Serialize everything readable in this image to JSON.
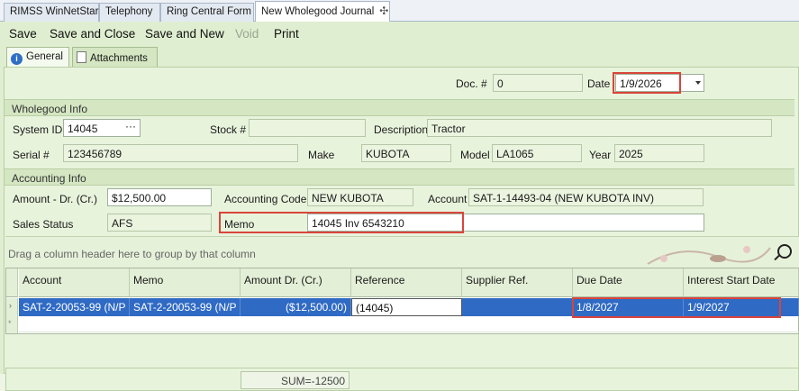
{
  "window_tabs": [
    {
      "label": "RIMSS WinNetStar"
    },
    {
      "label": "Telephony"
    },
    {
      "label": "Ring Central Form"
    },
    {
      "label": "New Wholegood Journal"
    }
  ],
  "toolbar": {
    "save": "Save",
    "save_and_close": "Save and Close",
    "save_and_new": "Save and New",
    "void": "Void",
    "print": "Print"
  },
  "inner_tabs": {
    "general": "General",
    "attachments": "Attachments"
  },
  "header": {
    "doc_label": "Doc. #",
    "doc_value": "0",
    "date_label": "Date",
    "date_value": "1/9/2026"
  },
  "wholegood_info": {
    "title": "Wholegood Info",
    "system_id_label": "System ID",
    "system_id_value": "14045",
    "system_id_button": "···",
    "stock_label": "Stock #",
    "stock_value": "",
    "description_label": "Description",
    "description_value": "Tractor",
    "serial_label": "Serial #",
    "serial_value": "123456789",
    "make_label": "Make",
    "make_value": "KUBOTA",
    "model_label": "Model",
    "model_value": "LA1065",
    "year_label": "Year",
    "year_value": "2025"
  },
  "accounting_info": {
    "title": "Accounting Info",
    "amount_label": "Amount - Dr. (Cr.)",
    "amount_value": "$12,500.00",
    "accounting_code_label": "Accounting Code",
    "accounting_code_value": "NEW KUBOTA",
    "account_label": "Account",
    "account_value": "SAT-1-14493-04 (NEW KUBOTA INV)",
    "sales_status_label": "Sales Status",
    "sales_status_value": "AFS",
    "memo_label": "Memo",
    "memo_value": "14045 Inv 6543210"
  },
  "grid": {
    "group_hint": "Drag a column header here to group by that column",
    "columns": [
      "Account",
      "Memo",
      "Amount Dr. (Cr.)",
      "Reference",
      "Supplier Ref.",
      "Due Date",
      "Interest Start Date"
    ],
    "row": {
      "account": "SAT-2-20053-99 (N/P ...",
      "memo": "SAT-2-20053-99 (N/P ...",
      "amount": "($12,500.00)",
      "reference": "(14045)",
      "supplier_ref": "",
      "due_date": "1/8/2027",
      "interest_start_date": "1/9/2027"
    },
    "sum": "SUM=-12500"
  }
}
